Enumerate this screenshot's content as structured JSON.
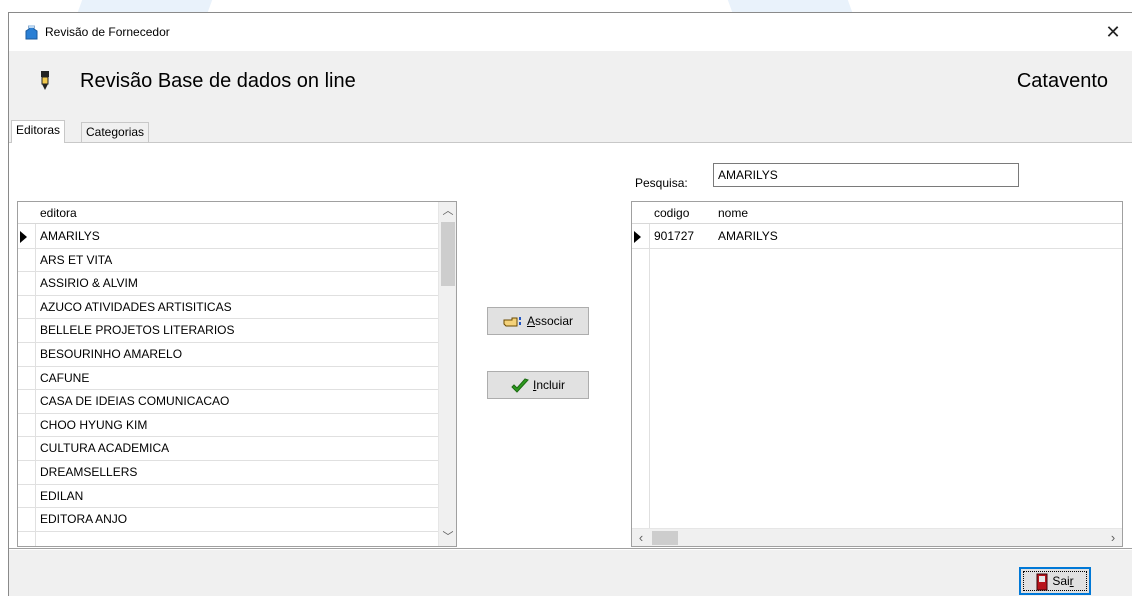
{
  "window": {
    "title": "Revisão de Fornecedor",
    "close_glyph": "✕"
  },
  "header": {
    "title": "Revisão Base de dados on line",
    "brand": "Catavento",
    "icon": "pen-icon"
  },
  "tabs": [
    {
      "label": "Editoras",
      "active": true
    },
    {
      "label": "Categorias",
      "active": false
    }
  ],
  "editoras_grid": {
    "column": "editora",
    "selected_index": 0,
    "rows": [
      "AMARILYS",
      "ARS ET VITA",
      "ASSIRIO & ALVIM",
      "AZUCO ATIVIDADES ARTISITICAS",
      "BELLELE PROJETOS LITERARIOS",
      "BESOURINHO AMARELO",
      "CAFUNE",
      "CASA DE IDEIAS COMUNICACAO",
      "CHOO HYUNG KIM",
      "CULTURA ACADEMICA",
      "DREAMSELLERS",
      "EDILAN",
      "EDITORA ANJO"
    ]
  },
  "search": {
    "label": "Pesquisa:",
    "value": "AMARILYS"
  },
  "results_grid": {
    "columns": [
      "codigo",
      "nome"
    ],
    "rows": [
      {
        "codigo": "901727",
        "nome": "AMARILYS"
      }
    ]
  },
  "buttons": {
    "associar": {
      "label_prefix": "",
      "accel": "A",
      "label_rest": "ssociar",
      "icon": "hand-pointing-icon"
    },
    "incluir": {
      "accel": "I",
      "label_rest": "ncluir",
      "icon": "checkmark-icon"
    },
    "sair": {
      "label_prefix": "Sai",
      "accel": "r",
      "icon": "exit-door-icon"
    }
  },
  "colors": {
    "accent": "#0078d7",
    "window_bg": "#f0f0f0",
    "check_green": "#2e9b1f"
  }
}
